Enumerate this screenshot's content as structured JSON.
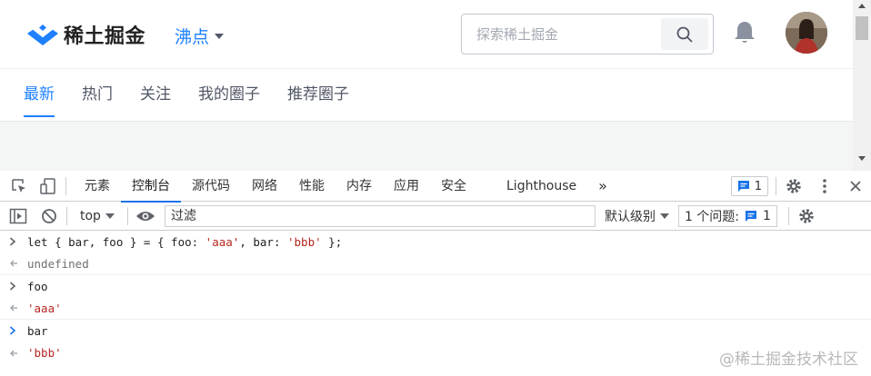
{
  "site": {
    "logo_text": "稀土掘金",
    "nav_label": "沸点",
    "search_placeholder": "探索稀土掘金",
    "tabs": [
      {
        "label": "最新",
        "active": true
      },
      {
        "label": "热门",
        "active": false
      },
      {
        "label": "关注",
        "active": false
      },
      {
        "label": "我的圈子",
        "active": false
      },
      {
        "label": "推荐圈子",
        "active": false
      }
    ],
    "accent": "#1e80ff"
  },
  "devtools": {
    "tabs": [
      {
        "label": "元素",
        "active": false
      },
      {
        "label": "控制台",
        "active": true
      },
      {
        "label": "源代码",
        "active": false
      },
      {
        "label": "网络",
        "active": false
      },
      {
        "label": "性能",
        "active": false
      },
      {
        "label": "内存",
        "active": false
      },
      {
        "label": "应用",
        "active": false
      },
      {
        "label": "安全",
        "active": false
      },
      {
        "label": "Lighthouse",
        "active": false
      }
    ],
    "more_tabs": "»",
    "issues_badge_count": "1",
    "context": "top",
    "filter_placeholder": "过滤",
    "levels": "默认级别",
    "issues_label": "1 个问题:",
    "issues_count": "1",
    "console": [
      {
        "kind": "input",
        "tokens": [
          {
            "t": "let { bar, foo } = { foo: ",
            "c": "plain"
          },
          {
            "t": "'aaa'",
            "c": "str"
          },
          {
            "t": ", bar: ",
            "c": "plain"
          },
          {
            "t": "'bbb'",
            "c": "str"
          },
          {
            "t": " };",
            "c": "plain"
          }
        ]
      },
      {
        "kind": "output",
        "text": "undefined",
        "style": "undef"
      },
      {
        "kind": "input",
        "text": "foo"
      },
      {
        "kind": "output",
        "text": "'aaa'",
        "style": "str"
      },
      {
        "kind": "input",
        "text": "bar",
        "prompt_active": true
      },
      {
        "kind": "output",
        "text": "'bbb'",
        "style": "str"
      }
    ]
  },
  "watermark": "@稀土掘金技术社区"
}
